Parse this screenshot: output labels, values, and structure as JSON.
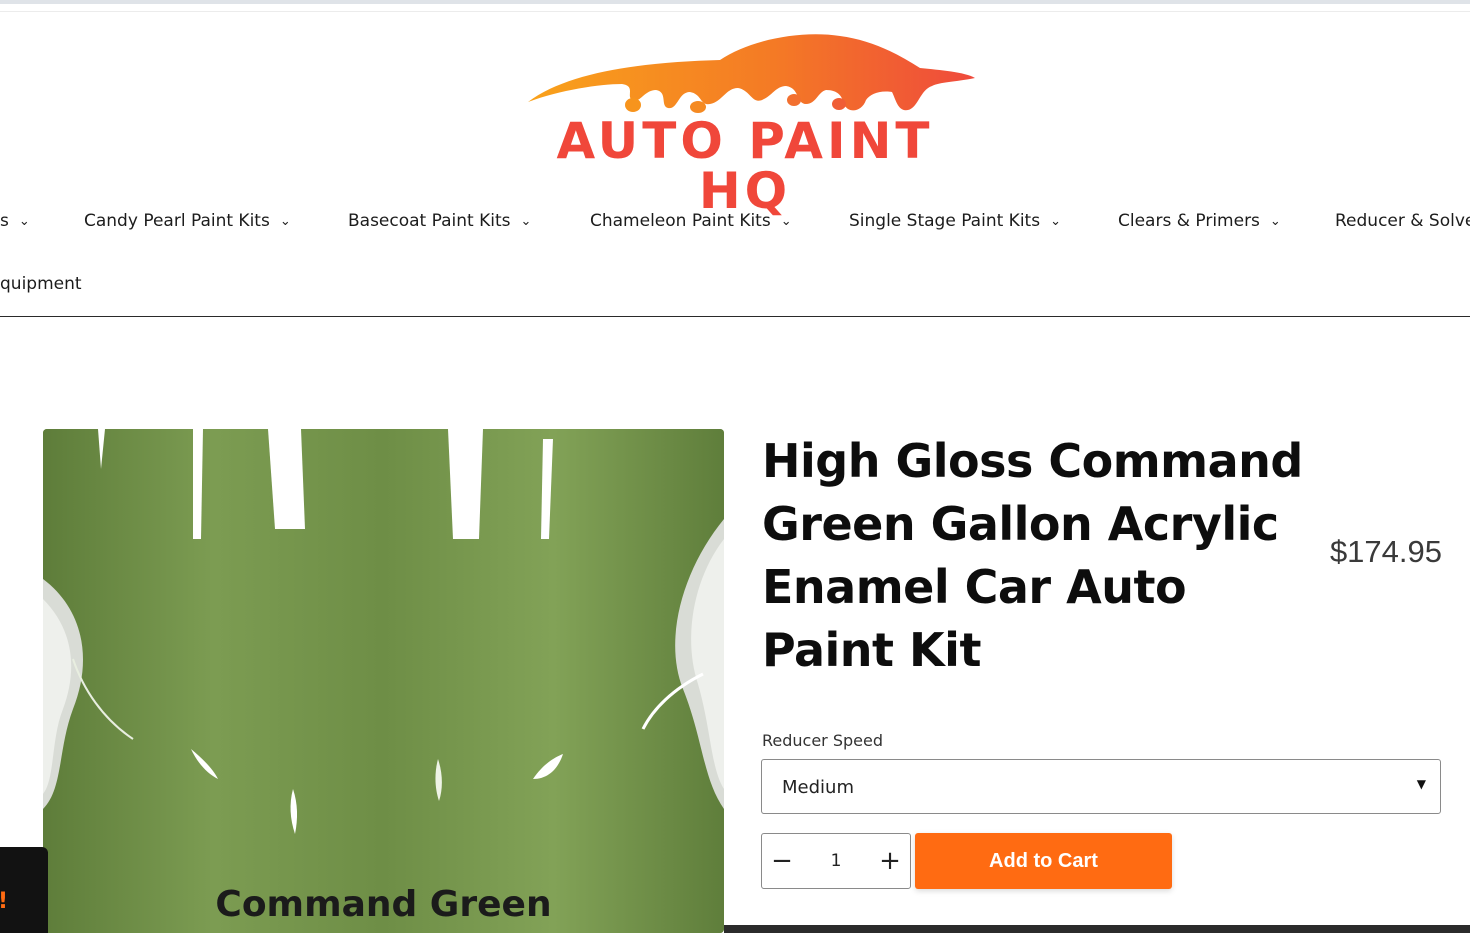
{
  "brand": {
    "logo_text": "AUTO PAINT HQ",
    "colors": {
      "logo_orange": "#f7941d",
      "logo_red": "#f0473a",
      "accent": "#ff6b12"
    }
  },
  "nav": {
    "items": [
      {
        "label": "s"
      },
      {
        "label": "Candy Pearl Paint Kits"
      },
      {
        "label": "Basecoat Paint Kits"
      },
      {
        "label": "Chameleon Paint Kits"
      },
      {
        "label": "Single Stage Paint Kits"
      },
      {
        "label": "Clears & Primers"
      },
      {
        "label": "Reducer & Solve"
      }
    ],
    "second_row_label": "quipment",
    "chevron_icon": "chevron-down-icon"
  },
  "product": {
    "image_caption": "Command Green",
    "title": "High Gloss Command Green Gallon Acrylic Enamel Car Auto Paint Kit",
    "price": "$174.95",
    "variant": {
      "label": "Reducer Speed",
      "selected": "Medium"
    },
    "quantity": {
      "minus": "−",
      "value": "1",
      "plus": "+"
    },
    "add_to_cart": "Add to Cart"
  },
  "floating_tab": {
    "mark": "!"
  }
}
